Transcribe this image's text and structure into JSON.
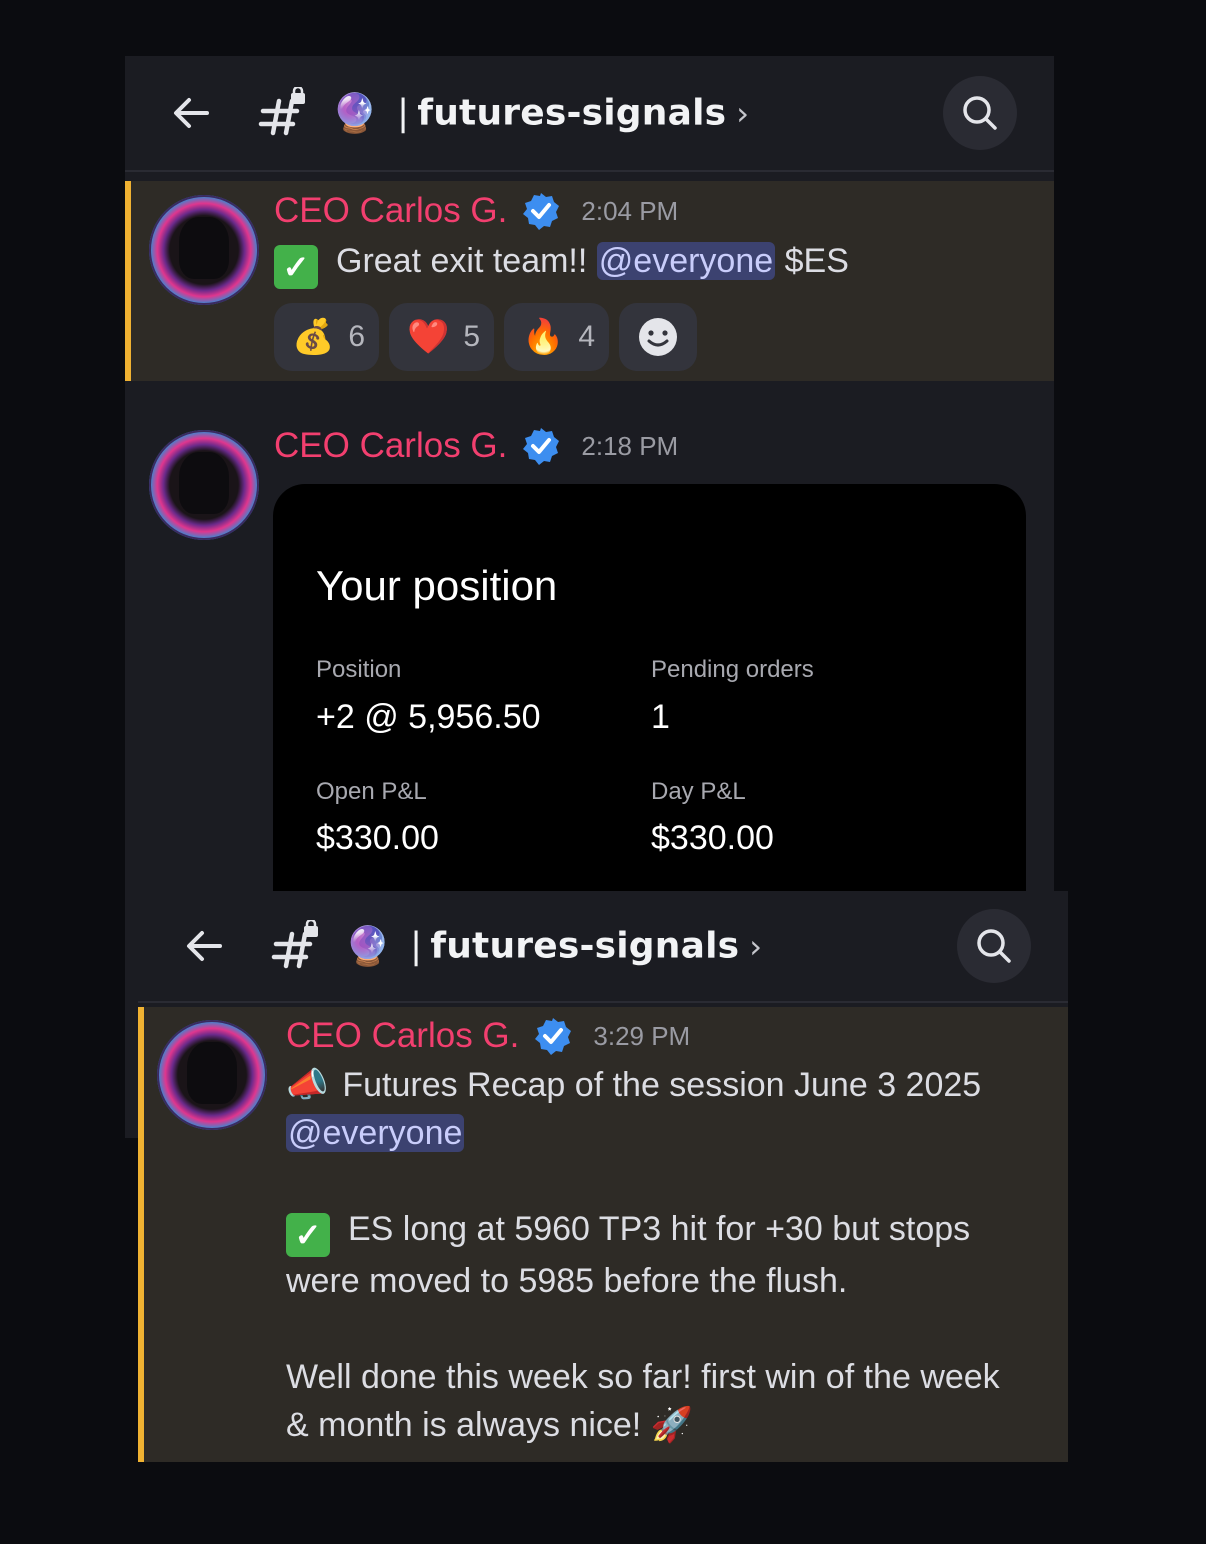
{
  "header": {
    "channel_name": "futures-signals",
    "separator": "|",
    "chevron": "›"
  },
  "messages": [
    {
      "author": "CEO Carlos G.",
      "time": "2:04 PM",
      "text": "Great exit team!!",
      "mention": "@everyone",
      "ticker": "$ES",
      "reactions": [
        {
          "emoji": "💰",
          "count": "6"
        },
        {
          "emoji": "❤️",
          "count": "5"
        },
        {
          "emoji": "🔥",
          "count": "4"
        }
      ]
    },
    {
      "author": "CEO Carlos G.",
      "time": "2:18 PM",
      "card": {
        "title": "Your position",
        "position_label": "Position",
        "position_value": "+2 @ 5,956.50",
        "pending_label": "Pending orders",
        "pending_value": "1",
        "open_pnl_label": "Open P&L",
        "open_pnl_value": "$330.00",
        "day_pnl_label": "Day P&L",
        "day_pnl_value": "$330.00"
      }
    },
    {
      "author": "CEO Carlos G.",
      "time": "3:29 PM",
      "line1": "Futures Recap of the session June 3 2025",
      "mention": "@everyone",
      "line2": "ES long at 5960 TP3 hit for +30 but stops",
      "line3": "were moved to 5985 before the flush.",
      "line4": "Well done this week so far! first win of the week",
      "line5": "& month is always nice!"
    }
  ],
  "icons": {
    "back": "arrow-left-icon",
    "channel": "locked-hash-icon",
    "orb": "🔮",
    "search": "search-icon",
    "verified": "verified-badge-icon",
    "check": "✓",
    "megaphone": "📣",
    "rocket": "🚀"
  },
  "colors": {
    "author": "#f23f6f",
    "mention_bg": "#3c4270",
    "highlight_bar": "#f0b232",
    "check_green": "#43b14a"
  }
}
